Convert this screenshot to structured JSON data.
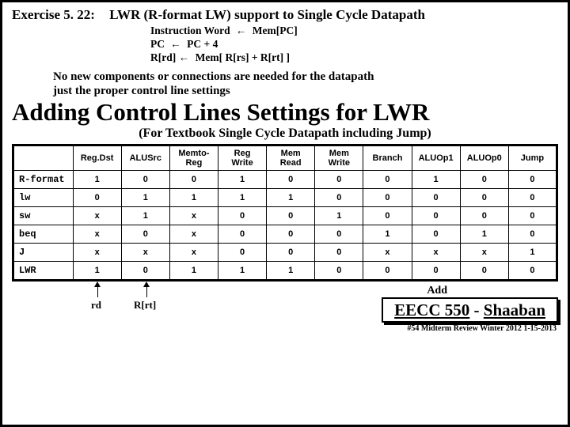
{
  "header": {
    "exercise_label": "Exercise 5. 22:",
    "title": "LWR (R-format LW) support to Single Cycle Datapath"
  },
  "rtl": {
    "line1_left": "Instruction Word",
    "line1_right": "Mem[PC]",
    "line2_left": "PC",
    "line2_right": "PC + 4",
    "line3_left": "R[rd]",
    "line3_right": "Mem[ R[rs] + R[rt] ]"
  },
  "note_line1": "No new components or connections are needed for the datapath",
  "note_line2": "just the proper control line settings",
  "main_heading": "Adding Control Lines Settings for LWR",
  "subtitle": "(For Textbook Single Cycle Datapath including Jump)",
  "table": {
    "headers": [
      "",
      "Reg.Dst",
      "ALUSrc",
      "Memto-\nReg",
      "Reg\nWrite",
      "Mem\nRead",
      "Mem\nWrite",
      "Branch",
      "ALUOp1",
      "ALUOp0",
      "Jump"
    ],
    "rows": [
      {
        "name": "R-format",
        "cells": [
          "1",
          "0",
          "0",
          "1",
          "0",
          "0",
          "0",
          "1",
          "0",
          "0"
        ]
      },
      {
        "name": "lw",
        "cells": [
          "0",
          "1",
          "1",
          "1",
          "1",
          "0",
          "0",
          "0",
          "0",
          "0"
        ]
      },
      {
        "name": "sw",
        "cells": [
          "x",
          "1",
          "x",
          "0",
          "0",
          "1",
          "0",
          "0",
          "0",
          "0"
        ]
      },
      {
        "name": "beq",
        "cells": [
          "x",
          "0",
          "x",
          "0",
          "0",
          "0",
          "1",
          "0",
          "1",
          "0"
        ]
      },
      {
        "name": "J",
        "cells": [
          "x",
          "x",
          "x",
          "0",
          "0",
          "0",
          "x",
          "x",
          "x",
          "1"
        ]
      },
      {
        "name": "LWR",
        "cells": [
          "1",
          "0",
          "1",
          "1",
          "1",
          "0",
          "0",
          "0",
          "0",
          "0"
        ]
      }
    ]
  },
  "annotations": {
    "rd": "rd",
    "rrt": "R[rt]",
    "add": "Add"
  },
  "course": {
    "code": "EECC 550",
    "sep": " - ",
    "author": "Shaaban"
  },
  "footer": "#54  Midterm Review  Winter 2012  1-15-2013"
}
